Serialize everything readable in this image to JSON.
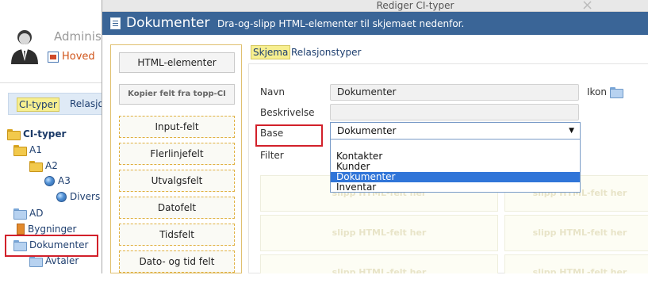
{
  "background_app": {
    "admin_name": "Adminis",
    "home_link": "Hoved",
    "tabs": {
      "ci_types": "CI-typer",
      "relations": "Relasjo"
    },
    "tree": {
      "root": "CI-typer",
      "items": [
        "A1",
        "A2",
        "A3",
        "Divers",
        "AD",
        "Bygninger",
        "Dokumenter",
        "Avtaler"
      ]
    }
  },
  "dialog": {
    "window_title": "Rediger CI-typer",
    "close_symbol": "×",
    "heading": "Dokumenter",
    "hint": "Dra-og-slipp HTML-elementer til skjemaet nedenfor.",
    "palette": {
      "html_elements_button": "HTML-elementer",
      "copy_fields_button": "Kopier felt fra topp-CI",
      "fields": [
        "Input-felt",
        "Flerlinjefelt",
        "Utvalgsfelt",
        "Datofelt",
        "Tidsfelt",
        "Dato- og tid felt"
      ]
    },
    "tabs": {
      "schema": "Skjema",
      "relations": "Relasjonstyper"
    },
    "form": {
      "name_label": "Navn",
      "name_value": "Dokumenter",
      "icon_label": "Ikon",
      "description_label": "Beskrivelse",
      "description_value": "",
      "base_label": "Base",
      "base_value": "Dokumenter",
      "base_arrow": "▼",
      "base_options": [
        "Kontakter",
        "Kunder",
        "Dokumenter",
        "Inventar"
      ],
      "base_selected_index": 2,
      "filter_label": "Filter"
    },
    "drop_placeholder": "slipp HTML-felt her"
  },
  "colors": {
    "header_blue": "#3a6597",
    "highlight_red": "#d2202a",
    "tab_yellow": "#f7ef90",
    "selection_blue": "#3075d8"
  }
}
